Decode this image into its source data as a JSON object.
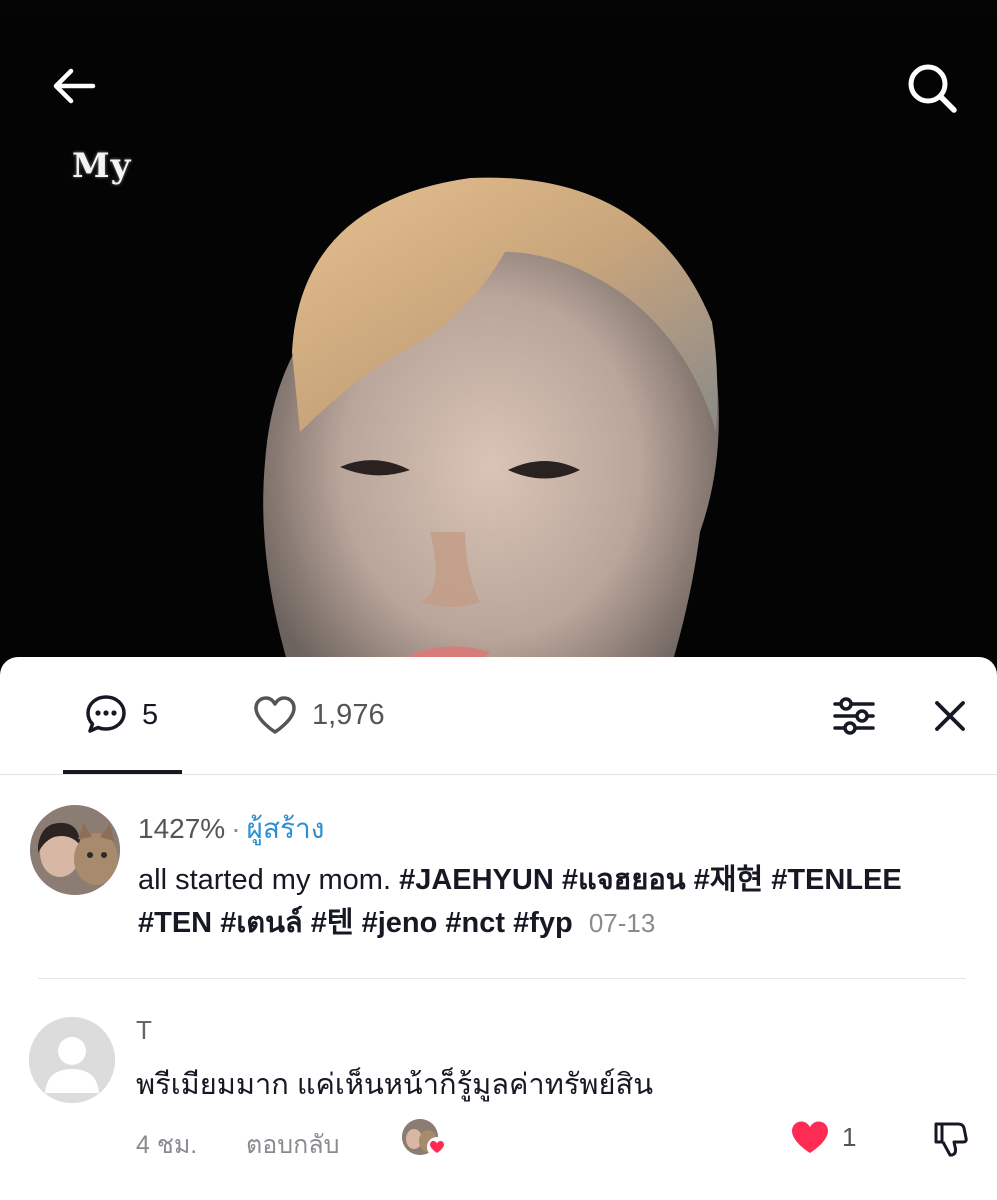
{
  "video": {
    "overlay_text": "My"
  },
  "nav": {
    "back_icon": "arrow-left-icon",
    "search_icon": "search-icon"
  },
  "tabs": {
    "comments_icon": "comment-bubble-icon",
    "comments_count": "5",
    "likes_icon": "heart-outline-icon",
    "likes_count": "1,976",
    "filter_icon": "sliders-icon",
    "close_icon": "close-icon"
  },
  "caption": {
    "username": "1427%",
    "separator": "·",
    "creator_label": "ผู้สร้าง",
    "text": "all started my mom.",
    "tags": [
      "#JAEHYUN",
      "#แจฮยอน",
      "#재현",
      "#TENLEE",
      "#TEN",
      "#เตนล์",
      "#텐",
      "#jeno",
      "#nct",
      "#fyp"
    ],
    "date": "07-13"
  },
  "comment": {
    "username": "T",
    "text": "พรีเมียมมาก แค่เห็นหน้าก็รู้มูลค่าทรัพย์สิน",
    "time": "4 ชม.",
    "reply_label": "ตอบกลับ",
    "like_count": "1",
    "liked": true,
    "liked_by_creator": true
  },
  "colors": {
    "accent_blue": "#2b8fd3",
    "like_red": "#fe2c55",
    "text_primary": "#161823",
    "text_secondary": "#8a8b91"
  }
}
